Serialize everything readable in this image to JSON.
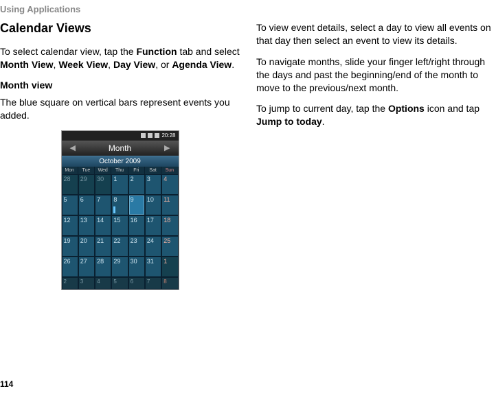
{
  "header": "Using Applications",
  "pageNumber": "114",
  "left": {
    "title": "Calendar Views",
    "p1a": "To select calendar view, tap the ",
    "p1b": "Function",
    "p1c": " tab and select ",
    "p1d": "Month View",
    "p1e": ", ",
    "p1f": "Week View",
    "p1g": ", ",
    "p1h": "Day View",
    "p1i": ", or ",
    "p1j": "Agenda View",
    "p1k": ".",
    "subhead": "Month view",
    "p2": "The blue square on vertical bars represent events you added."
  },
  "right": {
    "p1": "To view event details, select a day to view all events on that day then select an event to view its details.",
    "p2": "To navigate months, slide your finger left/right through the days and past the beginning/end of the month to move to the previous/next month.",
    "p3a": "To jump to current day, tap the ",
    "p3b": "Options",
    "p3c": " icon and tap ",
    "p3d": "Jump to today",
    "p3e": "."
  },
  "phone": {
    "time": "20:28",
    "tab": "Month",
    "monthTitle": "October 2009",
    "dow": [
      "Mon",
      "Tue",
      "Wed",
      "Thu",
      "Fri",
      "Sat",
      "Sun"
    ],
    "rows": [
      [
        "28",
        "29",
        "30",
        "1",
        "2",
        "3",
        "4"
      ],
      [
        "5",
        "6",
        "7",
        "8",
        "9",
        "10",
        "11"
      ],
      [
        "12",
        "13",
        "14",
        "15",
        "16",
        "17",
        "18"
      ],
      [
        "19",
        "20",
        "21",
        "22",
        "23",
        "24",
        "25"
      ],
      [
        "26",
        "27",
        "28",
        "29",
        "30",
        "31",
        "1"
      ]
    ],
    "nextRow": [
      "2",
      "3",
      "4",
      "5",
      "6",
      "7",
      "8"
    ]
  }
}
